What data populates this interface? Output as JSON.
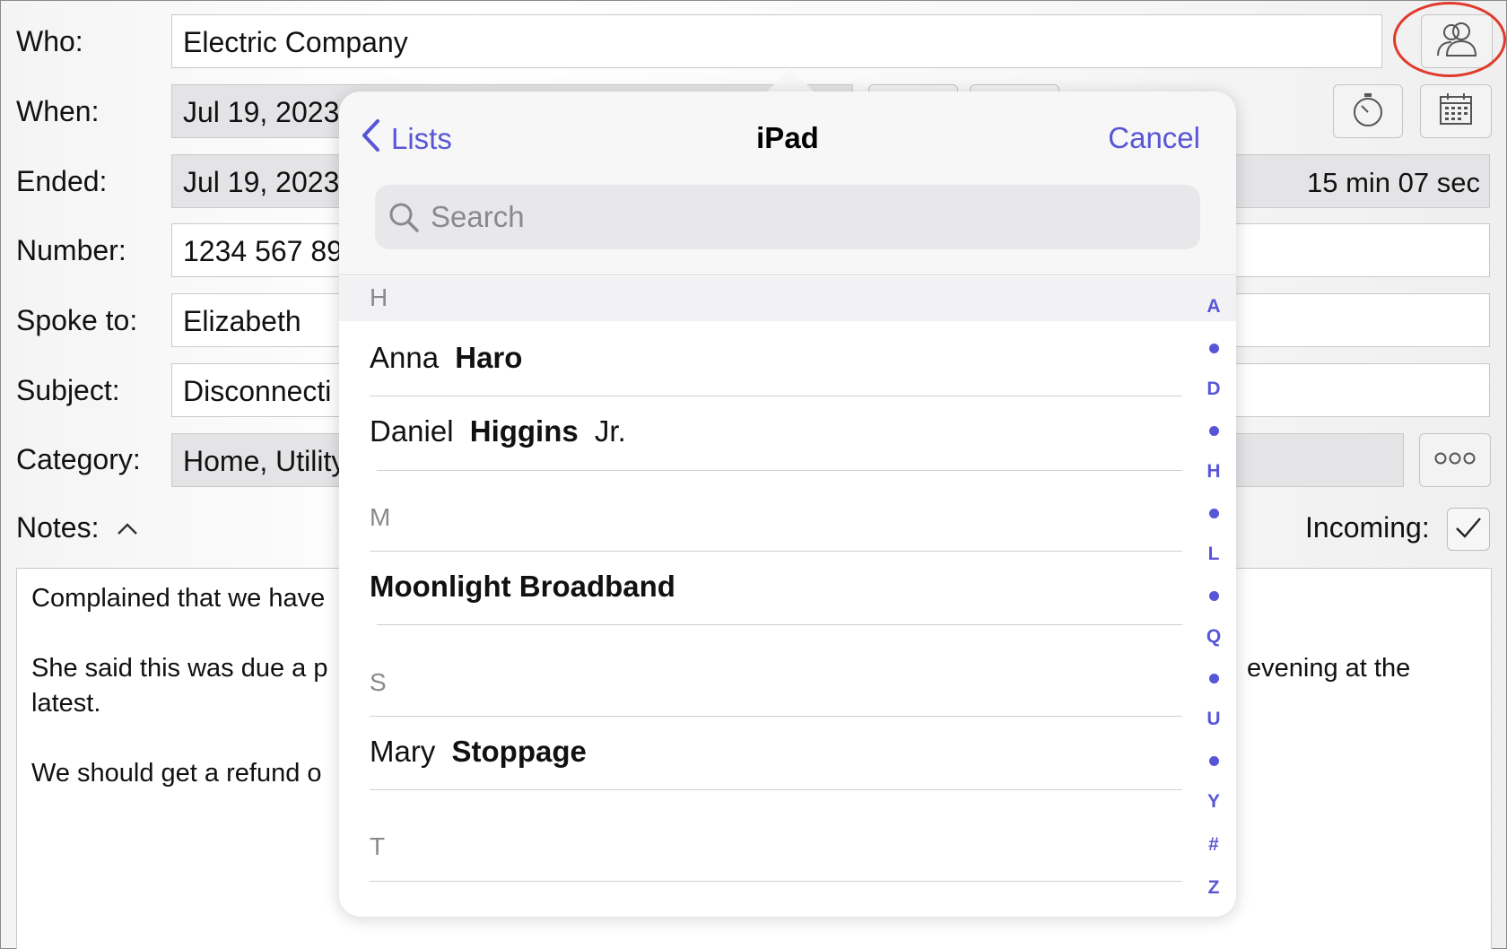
{
  "form": {
    "who_label": "Who:",
    "who_value": "Electric Company",
    "when_label": "When:",
    "when_value": "Jul 19, 2023",
    "ended_label": "Ended:",
    "ended_value": "Jul 19, 2023",
    "duration": "15 min 07 sec",
    "number_label": "Number:",
    "number_value": "1234 567 89",
    "spoke_label": "Spoke to:",
    "spoke_value": "Elizabeth",
    "subject_label": "Subject:",
    "subject_value": "Disconnecti",
    "category_label": "Category:",
    "category_value": "Home, Utility",
    "notes_label": "Notes:",
    "incoming_label": "Incoming:",
    "incoming_checked": true
  },
  "notes": {
    "line1": "Complained that we have",
    "line2": "She said this was due a p",
    "line2_right": "evening at the",
    "line3": "latest.",
    "line4": "We should get a refund o"
  },
  "popover": {
    "back_label": "Lists",
    "title": "iPad",
    "cancel_label": "Cancel",
    "search_placeholder": "Search",
    "sections": [
      {
        "letter": "H"
      },
      {
        "letter": "M"
      },
      {
        "letter": "S"
      },
      {
        "letter": "T"
      }
    ],
    "contacts": [
      {
        "first": "Anna",
        "last": "Haro",
        "suffix": ""
      },
      {
        "first": "Daniel",
        "last": "Higgins",
        "suffix": "Jr."
      },
      {
        "first": "",
        "last": "Moonlight Broadband",
        "suffix": ""
      },
      {
        "first": "Mary",
        "last": "Stoppage",
        "suffix": ""
      }
    ],
    "index_letters": [
      "A",
      "D",
      "H",
      "L",
      "Q",
      "U",
      "Y",
      "#",
      "Z"
    ]
  },
  "colors": {
    "accent": "#5856d6",
    "highlight_ring": "#e03a2b"
  },
  "icons": {
    "contacts_button": "contacts-people-icon",
    "timer_button": "stopwatch-icon",
    "calendar_button": "calendar-icon",
    "more_button": "ellipsis-icon",
    "back": "chevron-left-icon",
    "search": "magnifier-icon",
    "notes_toggle": "chevron-up-icon",
    "incoming": "checkmark-icon"
  }
}
